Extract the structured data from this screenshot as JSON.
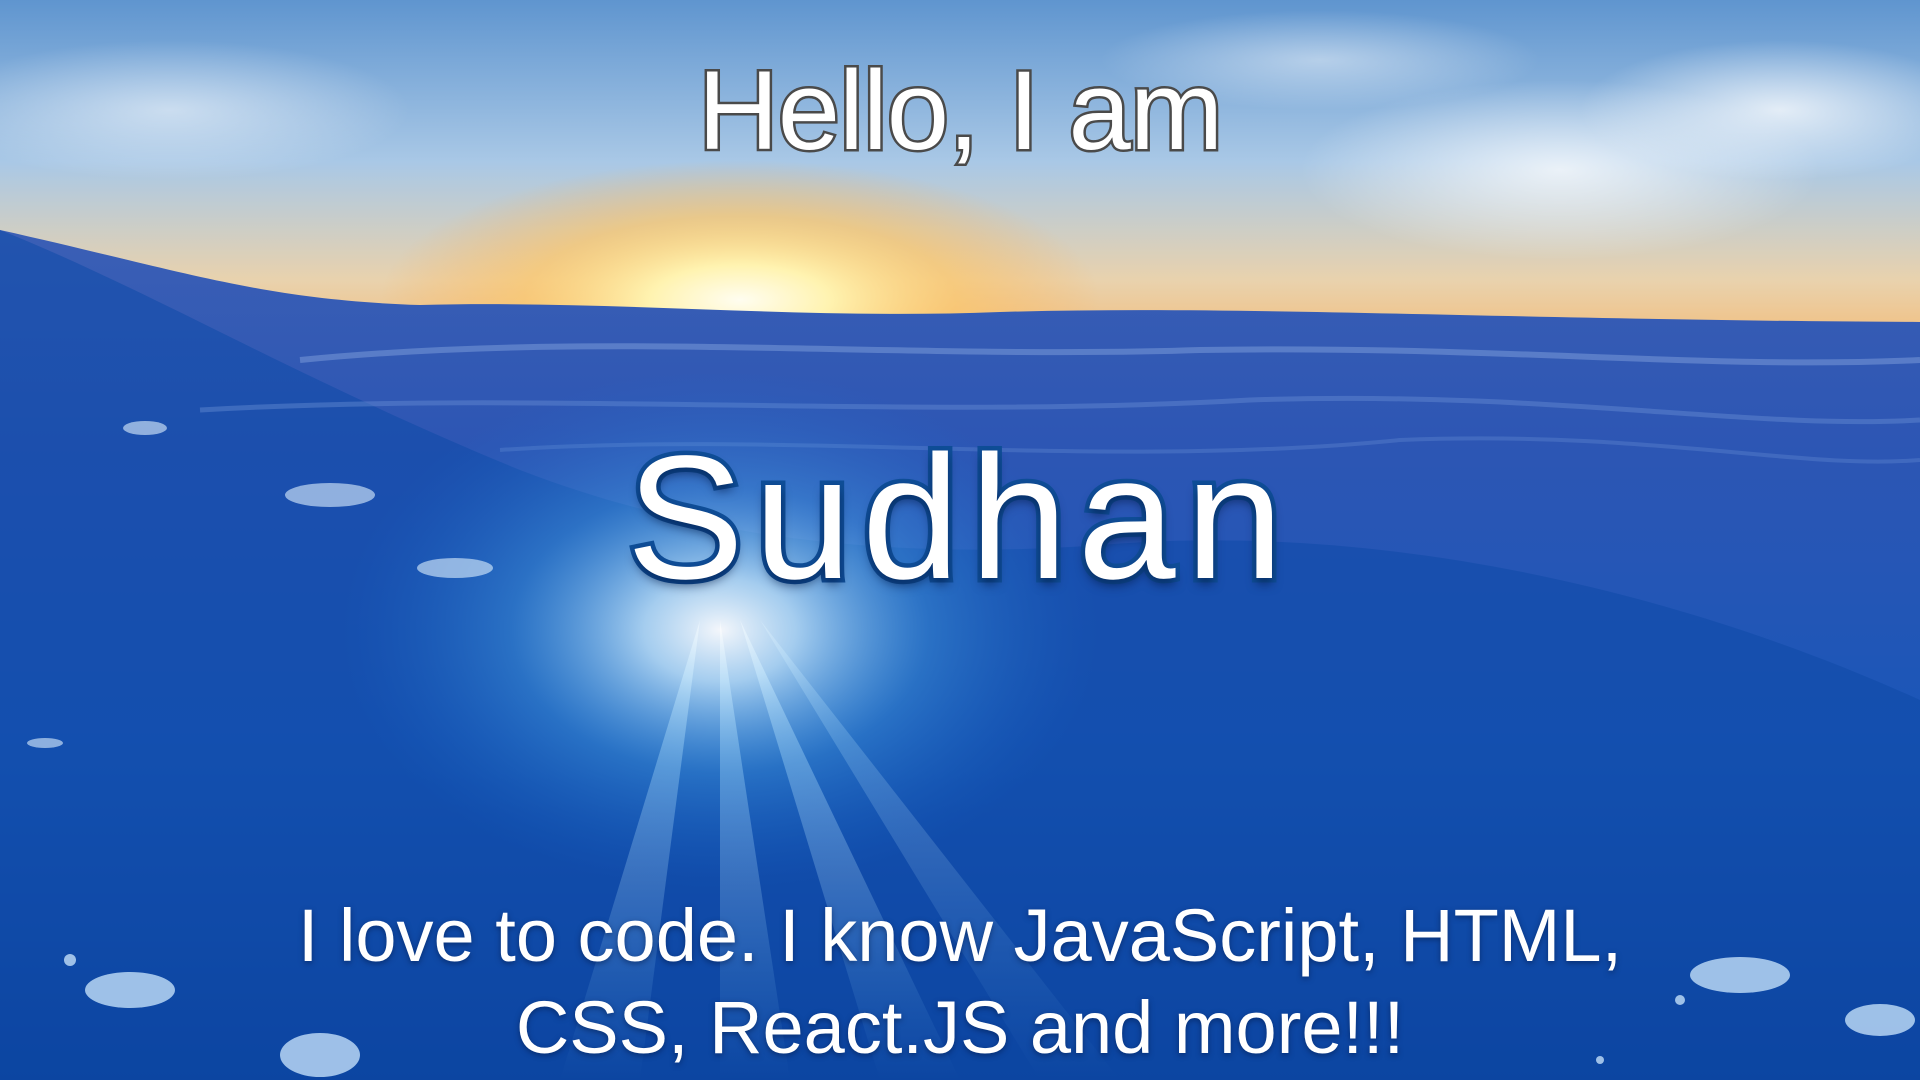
{
  "hero": {
    "greeting": "Hello, I am",
    "name": "Sudhan",
    "tagline_line1": "I love to code. I know JavaScript, HTML,",
    "tagline_line2": "CSS, React.JS and more!!!"
  },
  "colors": {
    "name_outline": "#0f4e98",
    "greeting_outline": "#4a4a4a",
    "text": "#ffffff"
  }
}
